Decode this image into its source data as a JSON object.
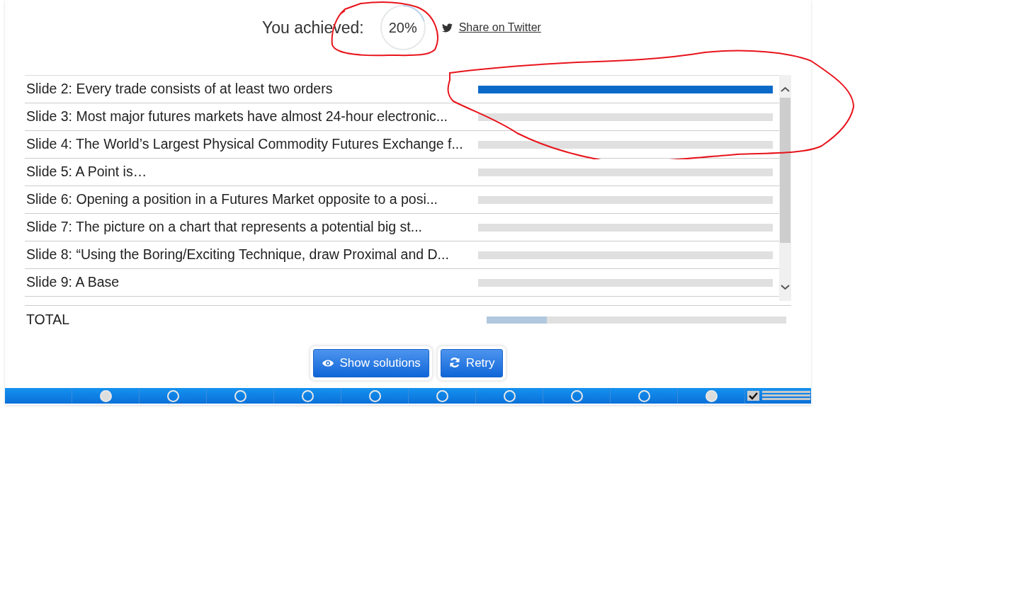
{
  "result": {
    "label": "You achieved:",
    "score": "20%",
    "level": 0.2,
    "share": "Share on Twitter"
  },
  "slides": [
    {
      "title": "Slide 2: Every trade consists of at least two orders",
      "passed": true
    },
    {
      "title": "Slide 3: Most major futures markets have almost 24-hour electronic...",
      "passed": false
    },
    {
      "title": "Slide 4: The World’s Largest Physical Commodity Futures Exchange f...",
      "passed": false
    },
    {
      "title": "Slide 5: A Point is…",
      "passed": false
    },
    {
      "title": "Slide 6: Opening a position in a Futures Market opposite to a posi...",
      "passed": false
    },
    {
      "title": "Slide 7: The picture on a chart that represents a potential big st...",
      "passed": false
    },
    {
      "title": "Slide 8: “Using the Boring/Exciting Technique, draw Proximal and D...",
      "passed": false
    },
    {
      "title": "Slide 9: A Base",
      "passed": false
    }
  ],
  "total": {
    "label": "TOTAL",
    "level": 0.2
  },
  "buttons": [
    {
      "kind": "solutions",
      "label": "Show solutions"
    },
    {
      "kind": "retry",
      "label": "Retry"
    }
  ],
  "nav_dots": [
    {
      "filled": true
    },
    {
      "filled": false
    },
    {
      "filled": false
    },
    {
      "filled": false
    },
    {
      "filled": false
    },
    {
      "filled": false
    },
    {
      "filled": false
    },
    {
      "filled": false
    },
    {
      "filled": false
    },
    {
      "filled": true
    }
  ],
  "summary_checked": true
}
